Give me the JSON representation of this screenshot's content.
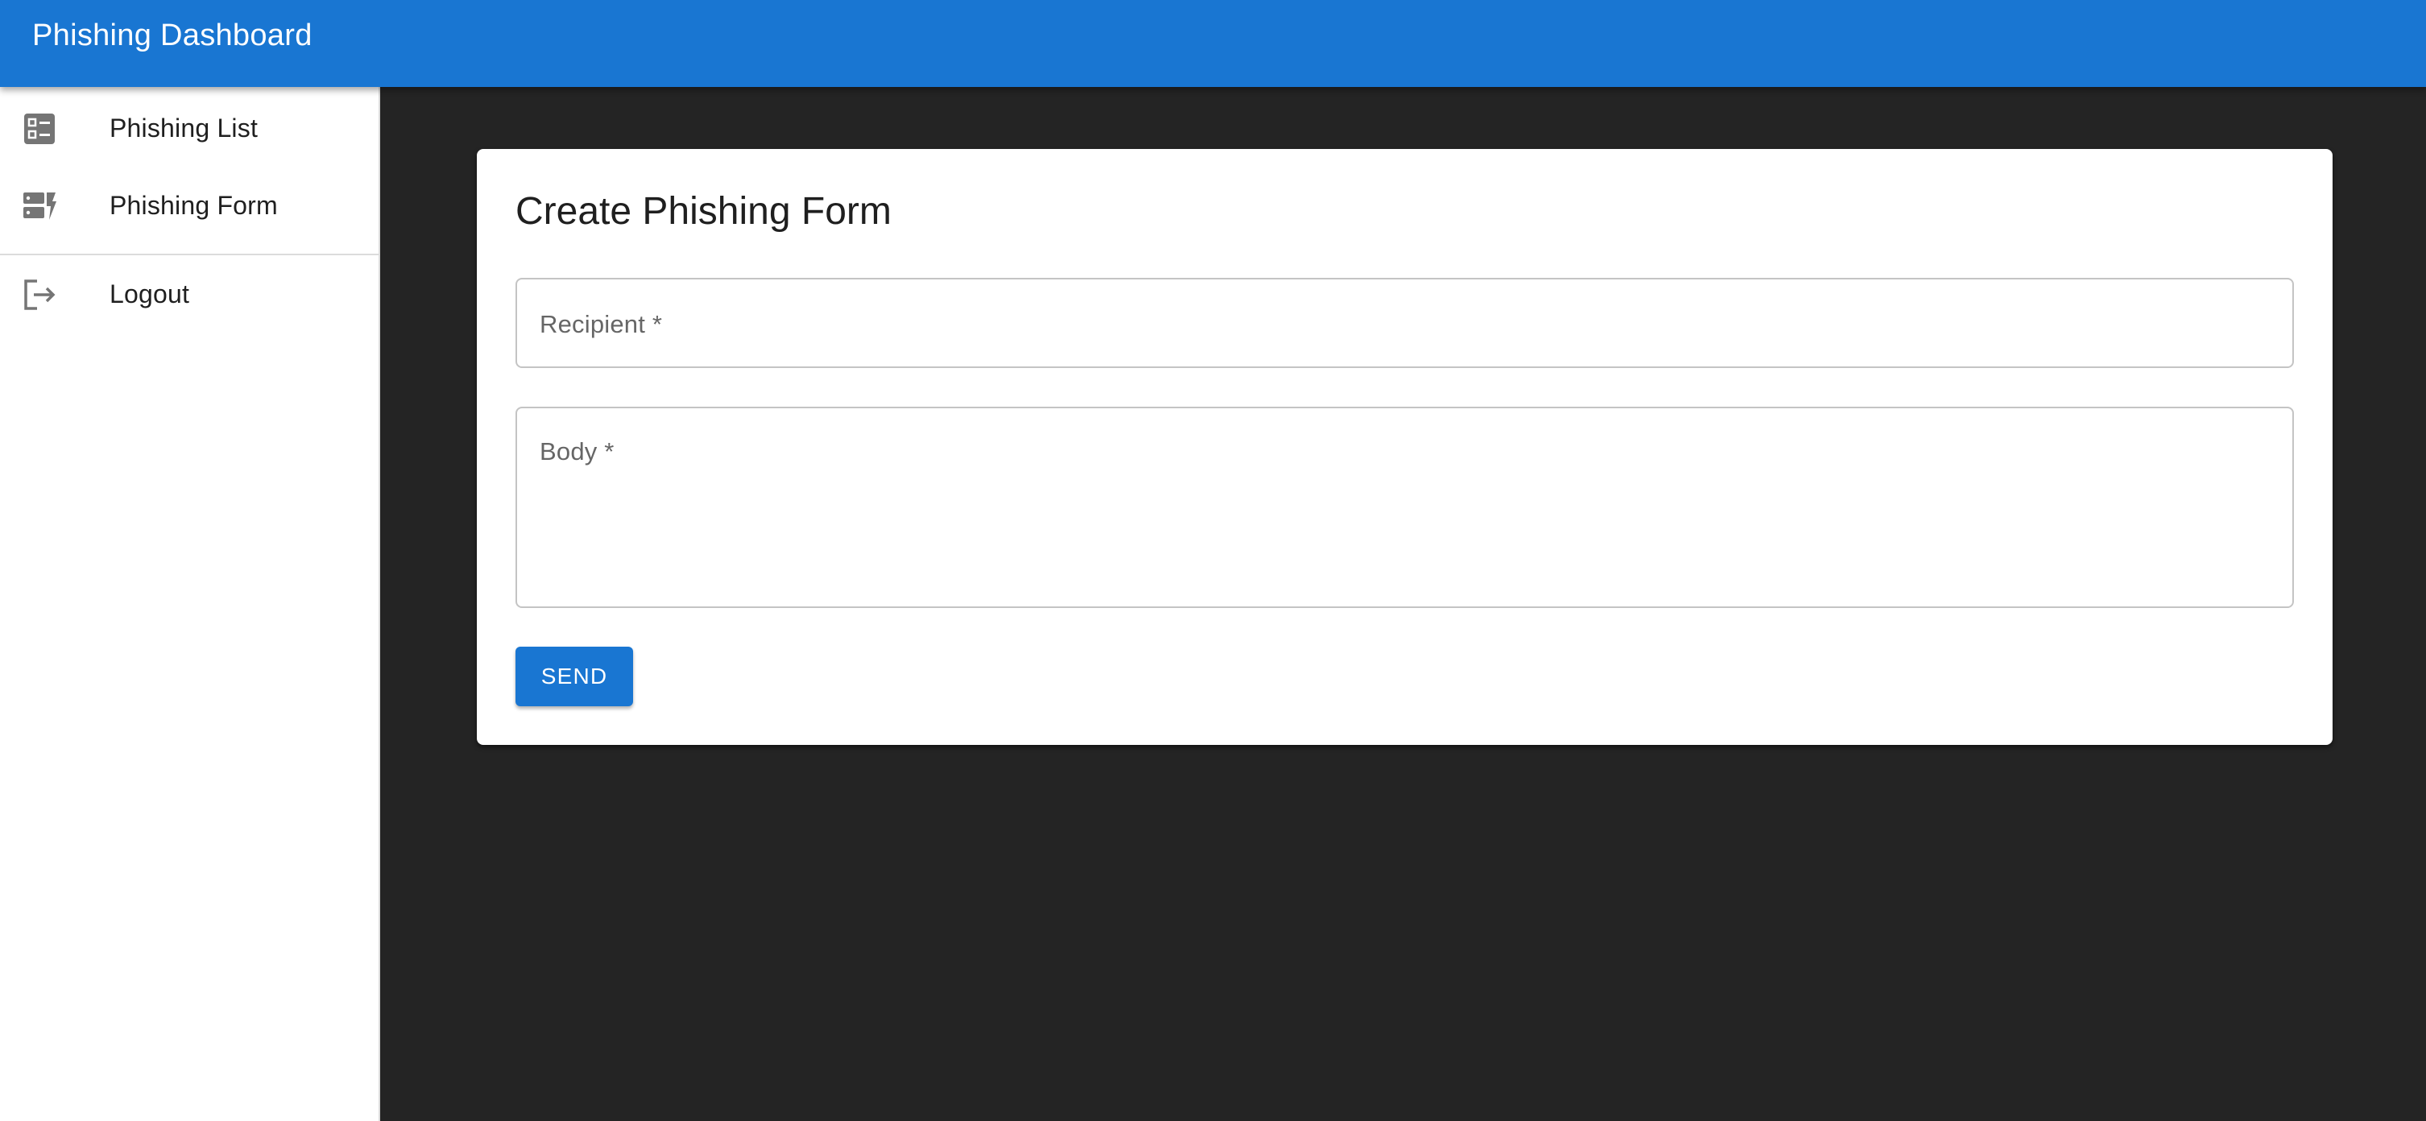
{
  "app": {
    "title": "Phishing Dashboard",
    "accent_color": "#1976d2",
    "background_color": "#242424"
  },
  "sidebar": {
    "items": [
      {
        "label": "Phishing List",
        "icon": "list-icon"
      },
      {
        "label": "Phishing Form",
        "icon": "dns-flash-icon"
      },
      {
        "label": "Logout",
        "icon": "logout-icon"
      }
    ]
  },
  "form": {
    "title": "Create Phishing Form",
    "recipient": {
      "label": "Recipient *",
      "value": ""
    },
    "body": {
      "label": "Body *",
      "value": ""
    },
    "send_label": "SEND"
  }
}
